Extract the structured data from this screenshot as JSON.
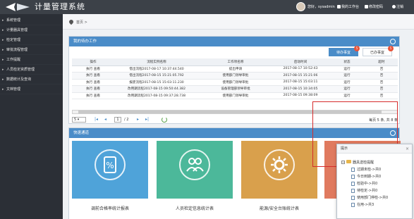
{
  "header": {
    "title": "计量管理系统",
    "greeting": "您好，sysadmin",
    "links": [
      {
        "label": "我的工作台"
      },
      {
        "label": "修改密码"
      },
      {
        "label": "注销"
      }
    ]
  },
  "sidebar": {
    "items": [
      {
        "label": "系统管理"
      },
      {
        "label": "计量器具管理"
      },
      {
        "label": "检定管理"
      },
      {
        "label": "审批流程管理"
      },
      {
        "label": "工作提醒"
      },
      {
        "label": "人员检定资质管理"
      },
      {
        "label": "数据统计及查询"
      },
      {
        "label": "文档管理"
      }
    ]
  },
  "breadcrumb": {
    "home": "首页",
    "sep": ">"
  },
  "todo": {
    "title": "我的待办工作",
    "tabs": [
      {
        "label": "待办事宜",
        "badge": "5"
      },
      {
        "label": "已办事宜",
        "badge": "5"
      }
    ],
    "columns": [
      "操作",
      "流程实例名称",
      "工作项名称",
      "启动时间",
      "状态",
      "超时"
    ],
    "rows": [
      {
        "action": "执行 查看",
        "name": "借出流程2017-08-17 10:37:44.540",
        "work": "提出申请",
        "start": "2017-08-17 10:52:43",
        "status": "运行",
        "timeout": "否"
      },
      {
        "action": "执行 查看",
        "name": "借出流程2017-08-15 15:21:05.792",
        "work": "使用部门领导审批",
        "start": "2017-08-15 15:21:06",
        "status": "运行",
        "timeout": "否"
      },
      {
        "action": "执行 查看",
        "name": "报废流程2017-08-15 15:03:11.230",
        "work": "使用部门领导审批",
        "start": "2017-08-15 15:03:11",
        "status": "运行",
        "timeout": "否"
      },
      {
        "action": "执行 查看",
        "name": "改用期流程2017-08-15 09:50:44.382",
        "work": "设备管理部领导审批",
        "start": "2017-08-15 10:34:05",
        "status": "运行",
        "timeout": "否"
      },
      {
        "action": "执行 查看",
        "name": "改用期流程2017-08-15 09:37:28.738",
        "work": "使用部门领导审批",
        "start": "2017-08-15 09:38:09",
        "status": "运行",
        "timeout": "否"
      }
    ],
    "pager": {
      "page_size": "5",
      "current_page": "1",
      "total_pages": "2",
      "info": "每页 5 条, 共 8 条"
    }
  },
  "quick": {
    "title": "快速通道",
    "tiles": [
      {
        "label": "调前合格率统计报表",
        "color": "#4fa3d9"
      },
      {
        "label": "人员检定信息统计表",
        "color": "#4cb89a"
      },
      {
        "label": "能源/安全台账统计表",
        "color": "#d9a04c"
      },
      {
        "label": "",
        "color": "#e07a5f"
      }
    ]
  },
  "tip": {
    "title": "提示",
    "close": "×",
    "root": "器具送检提醒",
    "children": [
      {
        "label": "过期未检->共0"
      },
      {
        "label": "今日到期->共0"
      },
      {
        "label": "检验中->共0"
      },
      {
        "label": "待检定->共0"
      },
      {
        "label": "使用部门停检->共0"
      },
      {
        "label": "在用->共3"
      }
    ]
  },
  "colors": {
    "header_bg": "#3c4148",
    "sidebar_bg": "#2b2f36",
    "panel_head": "#4a8cc8",
    "highlight": "#d62c2c"
  }
}
